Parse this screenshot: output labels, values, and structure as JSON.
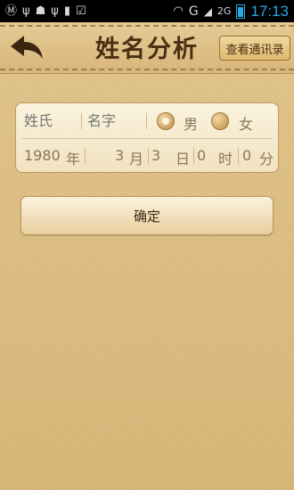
{
  "status_bar": {
    "time": "17:13",
    "network_label": "G",
    "indicator_text": "2G",
    "icons": [
      "m-app-icon",
      "usb-icon",
      "android-icon",
      "usb-icon",
      "sim-icon",
      "check-icon",
      "wifi-icon",
      "signal-icon",
      "battery-icon"
    ]
  },
  "header": {
    "title": "姓名分析",
    "contacts_button": "查看通讯录"
  },
  "form": {
    "surname_placeholder": "姓氏",
    "given_name_placeholder": "名字",
    "gender_options": [
      {
        "label": "男",
        "selected": true
      },
      {
        "label": "女",
        "selected": false
      }
    ],
    "birth": {
      "year_value": "1980",
      "year_unit": "年",
      "month_value": "3",
      "month_unit": "月",
      "day_value": "3",
      "day_unit": "日",
      "hour_value": "0",
      "hour_unit": "时",
      "minute_value": "0",
      "minute_unit": "分"
    }
  },
  "confirm_button": "确定",
  "colors": {
    "background": "#d9b97b",
    "title_text": "#4a2f12",
    "field_text": "#8b7658",
    "clock": "#27a9e1"
  }
}
